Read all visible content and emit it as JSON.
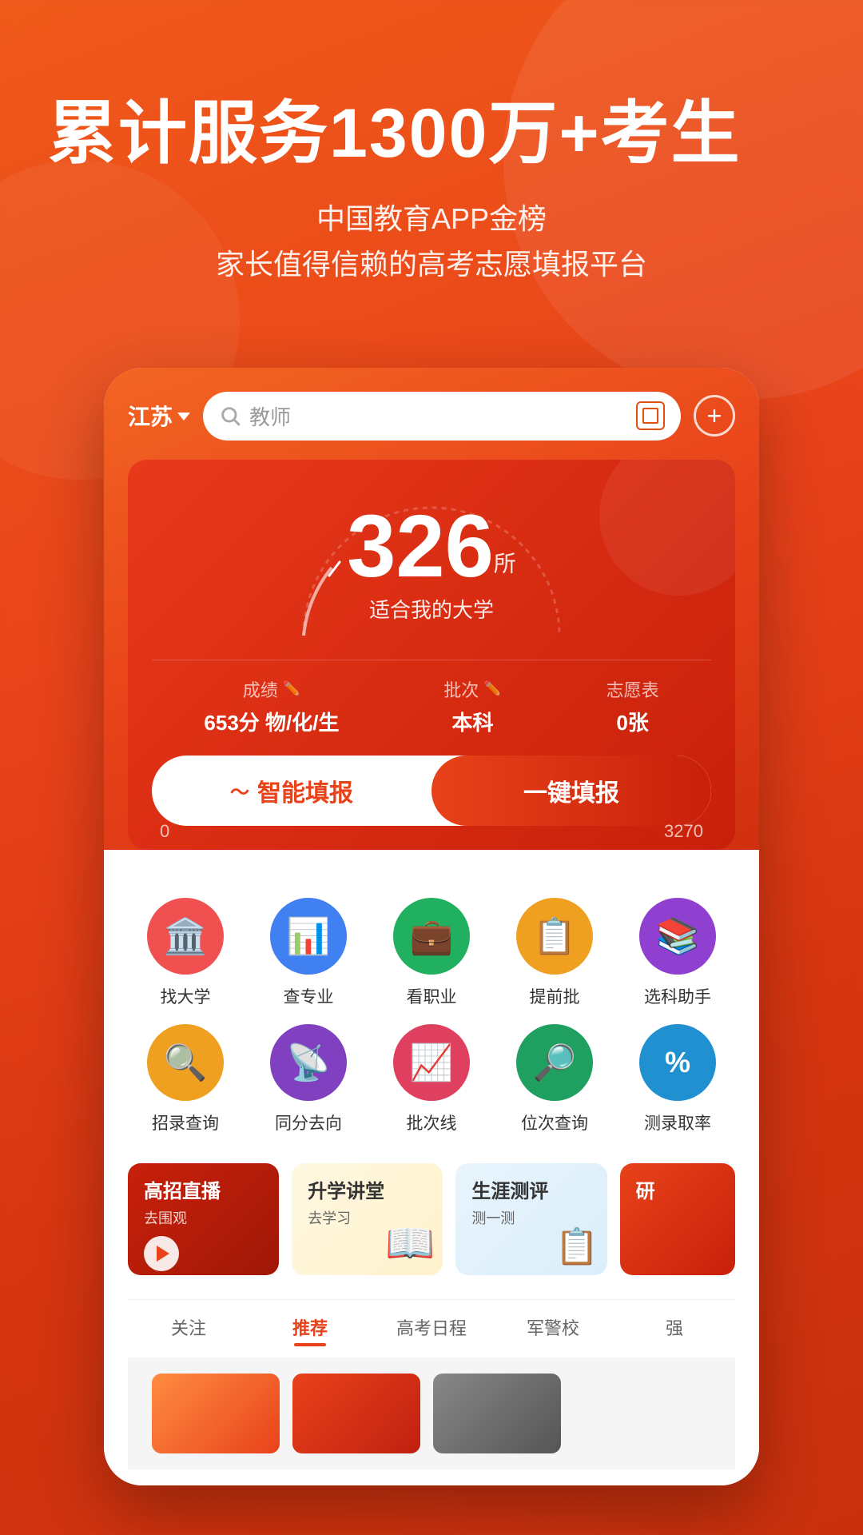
{
  "hero": {
    "title": "累计服务1300万+考生",
    "subtitle_line1": "中国教育APP金榜",
    "subtitle_line2": "家长值得信赖的高考志愿填报平台"
  },
  "app": {
    "province": "江苏",
    "search_placeholder": "教师",
    "score_count": "326",
    "score_unit": "所",
    "score_desc": "适合我的大学",
    "gauge_min": "0",
    "gauge_max": "3270",
    "fields": [
      {
        "label": "成绩",
        "value": "653分 物/化/生"
      },
      {
        "label": "批次",
        "value": "本科"
      },
      {
        "label": "志愿表",
        "value": "0张"
      }
    ],
    "btn_smart": "智能填报",
    "btn_quick": "一键填报",
    "icons": [
      {
        "label": "找大学",
        "color": "#f05050",
        "emoji": "🏛️"
      },
      {
        "label": "查专业",
        "color": "#4080f0",
        "emoji": "📊"
      },
      {
        "label": "看职业",
        "color": "#20b060",
        "emoji": "💼"
      },
      {
        "label": "提前批",
        "color": "#f0a020",
        "emoji": "📋"
      },
      {
        "label": "选科助手",
        "color": "#9040d0",
        "emoji": "📚"
      },
      {
        "label": "招录查询",
        "color": "#f0a020",
        "emoji": "🔍"
      },
      {
        "label": "同分去向",
        "color": "#8040c0",
        "emoji": "📡"
      },
      {
        "label": "批次线",
        "color": "#e04060",
        "emoji": "📈"
      },
      {
        "label": "位次查询",
        "color": "#20a060",
        "emoji": "🔎"
      },
      {
        "label": "测录取率",
        "color": "#2090d0",
        "emoji": "%"
      }
    ],
    "banners": [
      {
        "type": "dark-red",
        "title": "高招直播",
        "sub": "去围观",
        "icon": "📺"
      },
      {
        "type": "yellow",
        "title": "升学讲堂",
        "sub": "去学习",
        "icon": "📖"
      },
      {
        "type": "light-blue",
        "title": "生涯测评",
        "sub": "测一测",
        "icon": "📋"
      },
      {
        "type": "partial",
        "title": "研",
        "sub": "",
        "icon": ""
      }
    ],
    "tabs": [
      {
        "label": "关注",
        "active": false
      },
      {
        "label": "推荐",
        "active": true
      },
      {
        "label": "高考日程",
        "active": false
      },
      {
        "label": "军警校",
        "active": false
      },
      {
        "label": "强",
        "active": false
      }
    ]
  }
}
